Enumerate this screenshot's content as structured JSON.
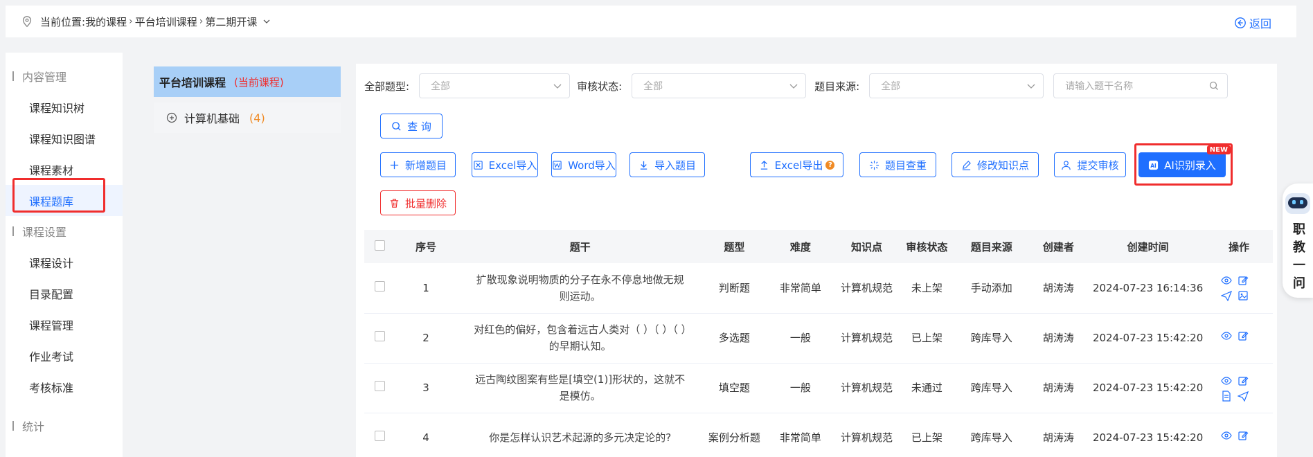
{
  "breadcrumb": {
    "label": "当前位置:",
    "items": [
      "我的课程",
      "平台培训课程",
      "第二期开课"
    ],
    "back": "返回"
  },
  "sidebar": {
    "groups": [
      {
        "title": "内容管理",
        "items": [
          "课程知识树",
          "课程知识图谱",
          "课程素材",
          "课程题库"
        ]
      },
      {
        "title": "课程设置",
        "items": [
          "课程设计",
          "目录配置",
          "课程管理",
          "作业考试",
          "考核标准"
        ]
      },
      {
        "title": "统计",
        "items": []
      }
    ],
    "active": "课程题库"
  },
  "tree": {
    "title": "平台培训课程",
    "current_tag": "(当前课程)",
    "node_label": "计算机基础",
    "node_count": "(4)"
  },
  "filters": {
    "type_label": "全部题型:",
    "type_value": "全部",
    "status_label": "审核状态:",
    "status_value": "全部",
    "source_label": "题目来源:",
    "source_value": "全部",
    "search_placeholder": "请输入题干名称"
  },
  "buttons": {
    "query": "查 询",
    "add": "新增题目",
    "excel_import": "Excel导入",
    "word_import": "Word导入",
    "import": "导入题目",
    "excel_export": "Excel导出",
    "dedupe": "题目查重",
    "modify_kp": "修改知识点",
    "submit_review": "提交审核",
    "ai_import": "AI识别录入",
    "new_badge": "NEW",
    "batch_delete": "批量删除"
  },
  "table": {
    "headers": [
      "序号",
      "题干",
      "题型",
      "难度",
      "知识点",
      "审核状态",
      "题目来源",
      "创建者",
      "创建时间",
      "操作"
    ],
    "rows": [
      {
        "no": "1",
        "stem": "扩散现象说明物质的分子在永不停息地做无规则运动。",
        "type": "判断题",
        "difficulty": "非常简单",
        "kp": "计算机规范",
        "status": "未上架",
        "source": "手动添加",
        "creator": "胡涛涛",
        "time": "2024-07-23 16:14:36",
        "ops": [
          "eye-icon",
          "edit-icon",
          "send-icon",
          "image-icon"
        ]
      },
      {
        "no": "2",
        "stem": "对红色的偏好，包含着远古人类对（ ）（ ）（ ）的早期认知。",
        "type": "多选题",
        "difficulty": "一般",
        "kp": "计算机规范",
        "status": "已上架",
        "source": "跨库导入",
        "creator": "胡涛涛",
        "time": "2024-07-23 15:42:20",
        "ops": [
          "eye-icon",
          "edit-icon"
        ]
      },
      {
        "no": "3",
        "stem": "远古陶纹图案有些是[填空(1)]形状的，这就不是模仿。",
        "type": "填空题",
        "difficulty": "一般",
        "kp": "计算机规范",
        "status": "未通过",
        "source": "跨库导入",
        "creator": "胡涛涛",
        "time": "2024-07-23 15:42:20",
        "ops": [
          "eye-icon",
          "edit-icon",
          "doc-icon",
          "send-icon"
        ]
      },
      {
        "no": "4",
        "stem": "你是怎样认识艺术起源的多元决定论的?",
        "type": "案例分析题",
        "difficulty": "非常简单",
        "kp": "计算机规范",
        "status": "已上架",
        "source": "跨库导入",
        "creator": "胡涛涛",
        "time": "2024-07-23 15:42:20",
        "ops": [
          "eye-icon",
          "edit-icon"
        ]
      }
    ]
  },
  "assistant": {
    "label": "职教一问"
  },
  "colors": {
    "primary": "#1f6fff",
    "danger": "#f02d2d",
    "tree_head": "#a8cff7"
  }
}
